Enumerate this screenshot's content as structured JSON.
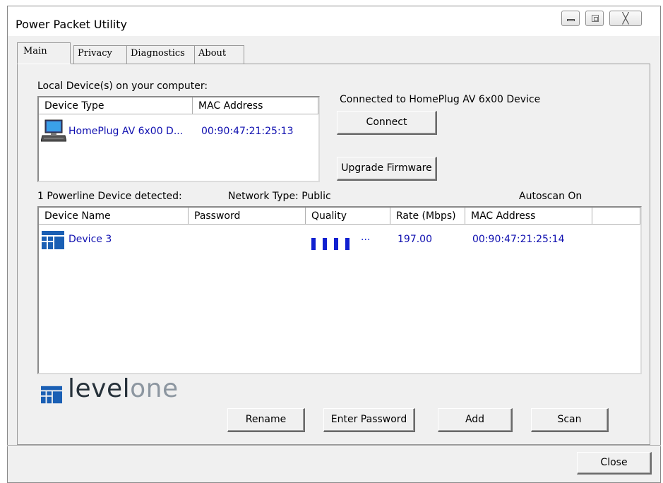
{
  "window": {
    "title": "Power Packet Utility",
    "controls": {
      "minimize": "minimize-icon",
      "maximize": "maximize-icon",
      "close_glyph": "╳"
    }
  },
  "tabs": [
    {
      "label": "Main",
      "active": true
    },
    {
      "label": "Privacy",
      "active": false
    },
    {
      "label": "Diagnostics",
      "active": false
    },
    {
      "label": "About",
      "active": false
    }
  ],
  "local_devices": {
    "label": "Local Device(s) on your computer:",
    "columns": [
      "Device Type",
      "MAC Address"
    ],
    "rows": [
      {
        "icon": "computer-icon",
        "device_type": "HomePlug AV 6x00 D...",
        "mac": "00:90:47:21:25:13"
      }
    ]
  },
  "connection": {
    "status": "Connected to HomePlug AV 6x00 Device",
    "connect_label": "Connect",
    "upgrade_label": "Upgrade Firmware"
  },
  "powerline": {
    "detected": "1 Powerline Device detected:",
    "network_type": "Network Type: Public",
    "autoscan": "Autoscan On",
    "columns": [
      "Device Name",
      "Password",
      "Quality",
      "Rate (Mbps)",
      "MAC Address"
    ],
    "rows": [
      {
        "icon": "levelone-device-icon",
        "name": "Device 3",
        "password": "",
        "quality_bars": 4,
        "quality_more": "...",
        "rate": "197.00",
        "mac": "00:90:47:21:25:14"
      }
    ]
  },
  "logo": {
    "text_level": "level",
    "text_one": "one",
    "mark": "levelone-logo-icon"
  },
  "actions": {
    "rename": "Rename",
    "enter_password": "Enter Password",
    "add": "Add",
    "scan": "Scan"
  },
  "footer": {
    "close": "Close"
  },
  "colors": {
    "link_blue": "#1010b0",
    "quality_blue": "#1020d0",
    "logo_blue": "#1a5fb4"
  }
}
